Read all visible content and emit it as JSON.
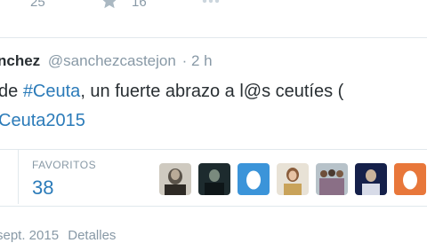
{
  "colors": {
    "link": "#2b7bb9",
    "muted": "#8899a6",
    "text": "#292f33",
    "divider": "#e1e8ed"
  },
  "top_actions": {
    "retweet_count": "25",
    "favorite_count": "16"
  },
  "tweet": {
    "author_name": "nchez",
    "author_handle": "@sanchezcastejon",
    "time": "· 2 h",
    "text_line1_prefix": "de ",
    "text_line1_hashtag": "#Ceuta",
    "text_line1_suffix": ", un fuerte abrazo a l@s ceutíes (",
    "text_line2_hashtag": "Ceuta2015"
  },
  "stats": {
    "favorites_label": "FAVORITOS",
    "favorites_value": "38"
  },
  "favoriters": [
    {
      "name": "favoriter-1",
      "kind": "photo"
    },
    {
      "name": "favoriter-2",
      "kind": "photo"
    },
    {
      "name": "favoriter-3",
      "kind": "default-egg"
    },
    {
      "name": "favoriter-4",
      "kind": "photo"
    },
    {
      "name": "favoriter-5",
      "kind": "photo"
    },
    {
      "name": "favoriter-6",
      "kind": "photo"
    },
    {
      "name": "favoriter-7",
      "kind": "default-egg"
    }
  ],
  "footer": {
    "date_fragment": "sept. 2015",
    "details_label": "Detalles"
  }
}
